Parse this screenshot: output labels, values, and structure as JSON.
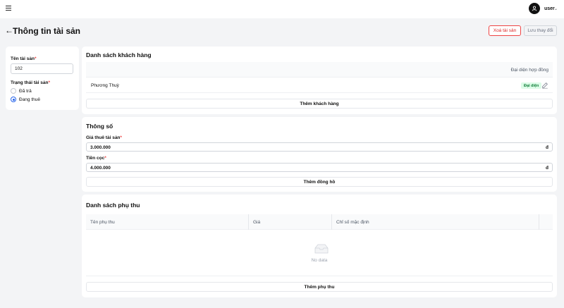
{
  "topbar": {
    "user_name": "user"
  },
  "header": {
    "title": "Thông tin tài sản",
    "delete_label": "Xoá tài sản",
    "save_label": "Lưu thay đổi"
  },
  "asset": {
    "name_label": "Tên tài sản",
    "name_value": "102",
    "status_label": "Trạng thái tài sản",
    "status_options": [
      "Đã trả",
      "Đang thuê"
    ],
    "status_selected": "Đang thuê"
  },
  "customers": {
    "title": "Danh sách khách hàng",
    "column_representative": "Đại diện hợp đồng",
    "rows": [
      {
        "name": "Phương Thuỳ",
        "badge": "Đại diện"
      }
    ],
    "add_label": "Thêm khách hàng"
  },
  "specs": {
    "title": "Thông số",
    "rent_label": "Giá thuê tài sản",
    "rent_value": "3.000.000",
    "deposit_label": "Tiền cọc",
    "deposit_value": "4.000.000",
    "currency": "đ",
    "add_meter_label": "Thêm đồng hồ"
  },
  "fees": {
    "title": "Danh sách phụ thu",
    "columns": [
      "Tên phụ thu",
      "Giá",
      "Chỉ số mặc định"
    ],
    "empty_text": "No data",
    "add_label": "Thêm phụ thu"
  },
  "colors": {
    "accent": "#2563eb",
    "danger": "#dc2626",
    "badge_bg": "#dcfce7",
    "badge_text": "#15803d"
  },
  "icons": [
    "menu-icon",
    "user-icon",
    "chevron-down-icon",
    "arrow-left-icon",
    "edit-icon",
    "empty-box-icon"
  ]
}
